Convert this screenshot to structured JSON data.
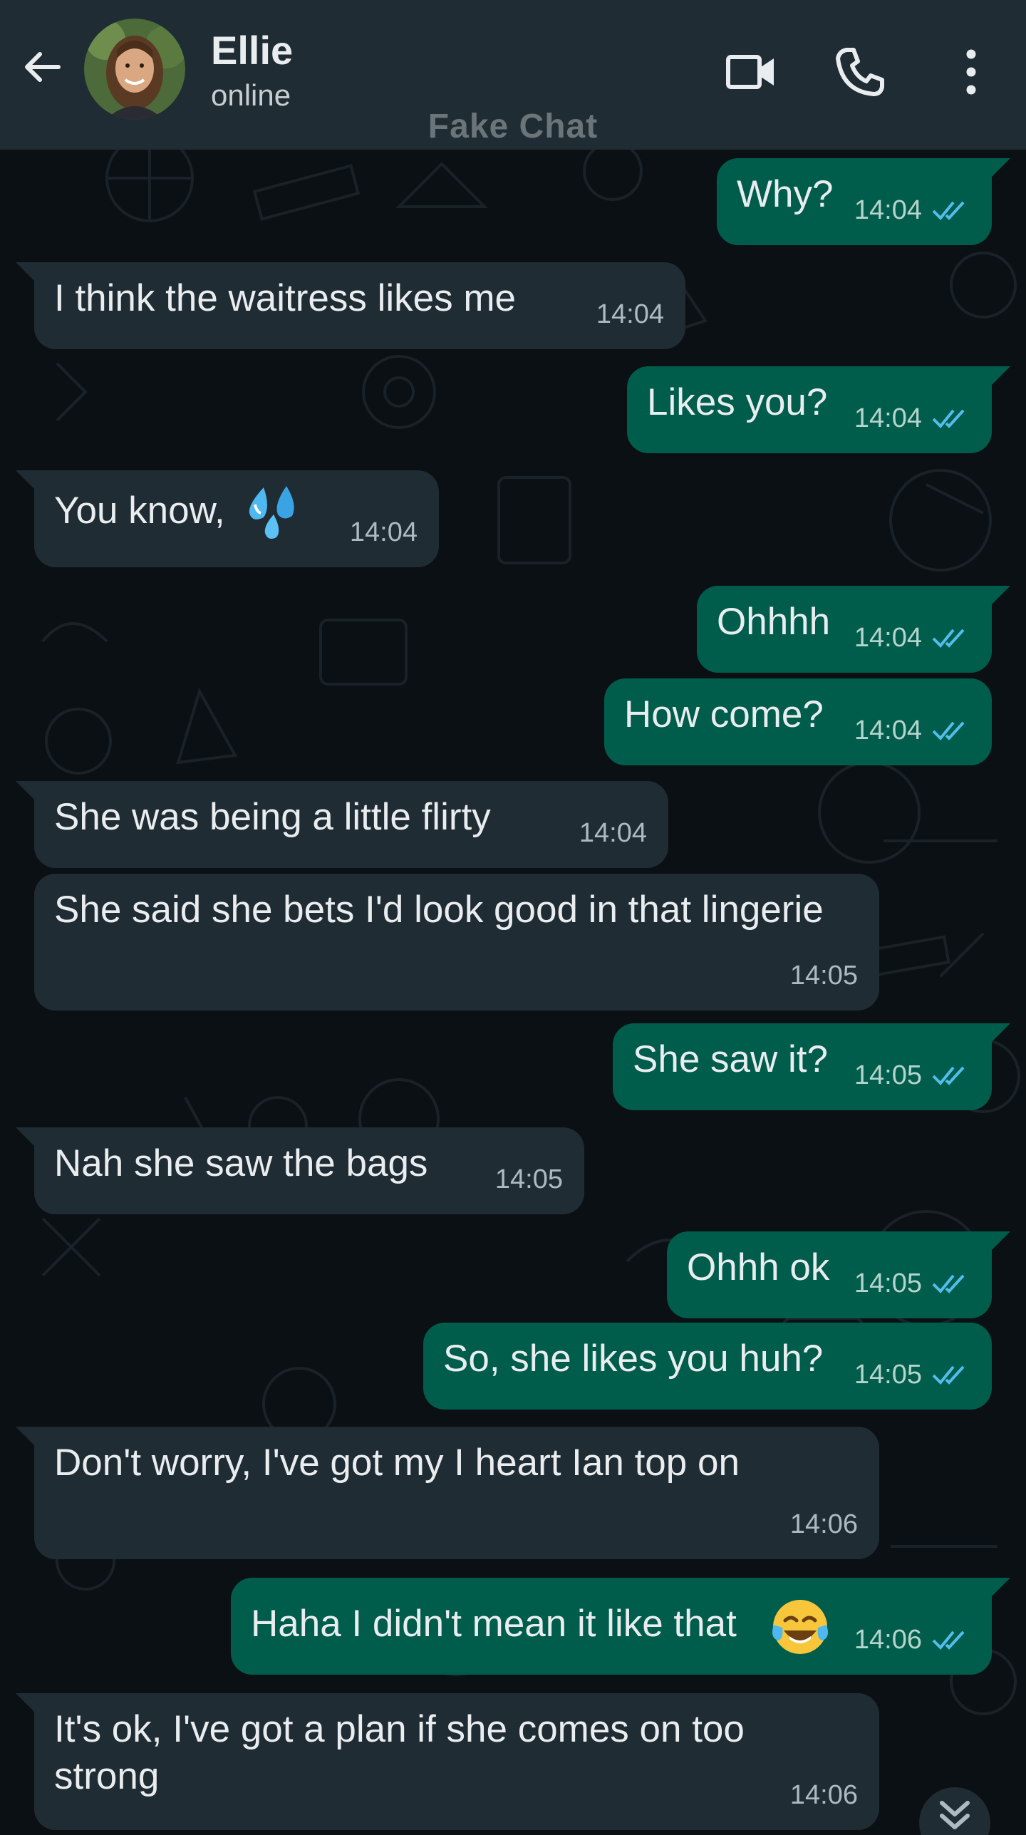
{
  "header": {
    "name": "Ellie",
    "status": "online",
    "watermark": "Fake Chat",
    "icons": [
      "back-arrow-icon",
      "video-call-icon",
      "phone-call-icon",
      "more-vertical-icon"
    ]
  },
  "colors": {
    "header_bg": "#1f2c34",
    "chat_bg": "#0b1014",
    "incoming_bubble": "#202c33",
    "outgoing_bubble": "#005c4b",
    "read_ticks": "#53bdeb"
  },
  "messages": [
    {
      "dir": "out",
      "text": "Why?",
      "time": "14:04",
      "read": true
    },
    {
      "dir": "in",
      "text": "I think the waitress likes me",
      "time": "14:04"
    },
    {
      "dir": "out",
      "text": "Likes you?",
      "time": "14:04",
      "read": true
    },
    {
      "dir": "in",
      "text": "You know,",
      "emoji": "sweat-droplets-emoji",
      "time": "14:04"
    },
    {
      "dir": "out",
      "text": "Ohhhh",
      "time": "14:04",
      "read": true
    },
    {
      "dir": "out",
      "text": "How come?",
      "time": "14:04",
      "read": true
    },
    {
      "dir": "in",
      "text": "She was being a little flirty",
      "time": "14:04"
    },
    {
      "dir": "in",
      "text": "She said she bets I'd look good in that lingerie",
      "time": "14:05"
    },
    {
      "dir": "out",
      "text": "She saw it?",
      "time": "14:05",
      "read": true
    },
    {
      "dir": "in",
      "text": "Nah she saw the bags",
      "time": "14:05"
    },
    {
      "dir": "out",
      "text": "Ohhh ok",
      "time": "14:05",
      "read": true
    },
    {
      "dir": "out",
      "text": "So, she likes you huh?",
      "time": "14:05",
      "read": true
    },
    {
      "dir": "in",
      "text": "Don't worry, I've got my I heart Ian top on",
      "time": "14:06"
    },
    {
      "dir": "out",
      "text": "Haha I didn't mean it like that",
      "emoji": "tears-of-joy-emoji",
      "time": "14:06",
      "read": true
    },
    {
      "dir": "in",
      "text": "It's ok, I've got a plan if she comes on too strong",
      "time": "14:06"
    }
  ]
}
